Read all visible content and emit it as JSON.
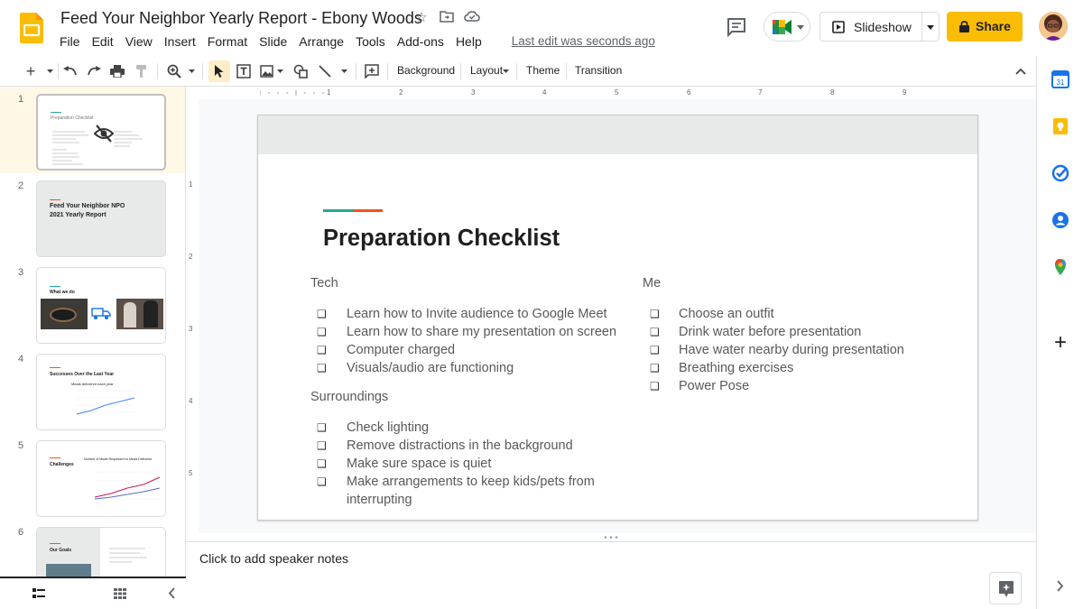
{
  "app": {
    "doc_title": "Feed Your Neighbor Yearly Report - Ebony Woods",
    "menu": [
      "File",
      "Edit",
      "View",
      "Insert",
      "Format",
      "Slide",
      "Arrange",
      "Tools",
      "Add-ons",
      "Help"
    ],
    "last_edit": "Last edit was seconds ago",
    "slideshow_label": "Slideshow",
    "share_label": "Share",
    "brand_color": "#fbbc04"
  },
  "toolbar": {
    "background_label": "Background",
    "layout_label": "Layout",
    "theme_label": "Theme",
    "transition_label": "Transition"
  },
  "ruler": {
    "horizontal": [
      "1",
      "2",
      "3",
      "4",
      "5",
      "6",
      "7",
      "8",
      "9"
    ],
    "vertical": [
      "1",
      "2",
      "3",
      "4",
      "5"
    ]
  },
  "filmstrip": {
    "slides": [
      {
        "num": "1",
        "title": "Preparation Checklist"
      },
      {
        "num": "2",
        "title": "Feed Your Neighbor NPO",
        "subtitle": "2021 Yearly Report"
      },
      {
        "num": "3",
        "title": "What we do"
      },
      {
        "num": "4",
        "title": "Successes Over the Last Year",
        "subtitle": "Meals delivered each year"
      },
      {
        "num": "5",
        "title": "Challenges",
        "subtitle": "Number of Meals Requested vs Meals Delivered"
      },
      {
        "num": "6",
        "title": "Our Goals"
      }
    ]
  },
  "slide": {
    "title": "Preparation Checklist",
    "accent_colors": [
      "#26a69a",
      "#f4511e"
    ],
    "checkbox_glyph": "❑",
    "tech": {
      "heading": "Tech",
      "items": [
        "Learn how to Invite audience to Google Meet",
        "Learn how to share my presentation on screen",
        "Computer charged",
        "Visuals/audio are functioning"
      ]
    },
    "surroundings": {
      "heading": "Surroundings",
      "items": [
        "Check lighting",
        "Remove distractions in the background",
        "Make sure space is quiet",
        "Make arrangements to keep kids/pets from",
        "interrupting"
      ]
    },
    "me": {
      "heading": "Me",
      "items": [
        "Choose an outfit",
        "Drink water before presentation",
        "Have water nearby during presentation",
        "Breathing exercises",
        "Power Pose"
      ]
    }
  },
  "notes": {
    "placeholder": "Click to add speaker notes"
  }
}
